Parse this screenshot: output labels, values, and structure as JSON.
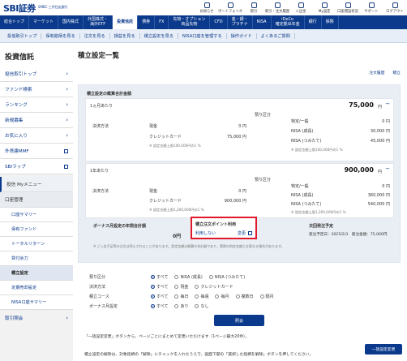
{
  "header": {
    "logo": "SBI証券",
    "logo_sub": "SMBC 三井住友銀行",
    "icons": [
      {
        "name": "notice-icon",
        "label": "お知らせ"
      },
      {
        "name": "portfolio-icon",
        "label": "ポートフォリオ"
      },
      {
        "name": "transfer-icon",
        "label": "取引"
      },
      {
        "name": "history-icon",
        "label": "取引・注文履歴"
      },
      {
        "name": "deposit-icon",
        "label": "入出金"
      },
      {
        "name": "mypage-icon",
        "label": "My設定"
      },
      {
        "name": "ideco-icon",
        "label": "口座開設状況"
      },
      {
        "name": "support-icon",
        "label": "サポート"
      },
      {
        "name": "logout-icon",
        "label": "ログアウト"
      }
    ]
  },
  "mainnav": [
    "総合トップ",
    "マーケット",
    "国内株式",
    "外国株式・\n海外ETF",
    "投資信託",
    "債券",
    "FX",
    "先物・オプション\n商品先物",
    "CFD",
    "金・銀・\nプラチナ",
    "NISA",
    "iDeCo\n確定拠出年金",
    "銀行",
    "保険"
  ],
  "subnav": [
    "投信取引トップ",
    "保有銘柄を見る",
    "注文を見る",
    "損益を見る",
    "積立設定を見る",
    "NISA口座を管理する",
    "操作ガイド",
    "よくあるご質問"
  ],
  "sidebar": {
    "title": "投資信託",
    "items": [
      "投信取引トップ",
      "ファンド検索",
      "ランキング",
      "新規募集",
      "お気に入り",
      "外貨建MMF",
      "SBIラップ"
    ],
    "section_my": "投信 Myメニュー",
    "section_account": "口座管理",
    "sub_items": [
      "口座サマリー",
      "保有ファンド",
      "トータルリターン",
      "買付余力",
      "積立設定",
      "定期売却設定",
      "NISA口座サマリー"
    ],
    "bottom": "取引照会"
  },
  "page": {
    "title": "積立設定一覧",
    "link_history": "注文履歴",
    "link_top": "積立"
  },
  "summary": {
    "heading": "積立設定の概算合計金額",
    "month_label": "1ヵ月あたり",
    "month_total": "75,000",
    "yen": "円",
    "method_label": "決済方法",
    "cash_label": "現金",
    "cash_month": "0 円",
    "credit_label": "クレジットカード",
    "credit_month": "75,000 円",
    "credit_note_m": "※ 設定金額上限100,000円の1 %",
    "account_label": "預り区分",
    "specific_label": "特定/一般",
    "specific_month": "0 円",
    "nisa_growth_label": "NISA (成長)",
    "nisa_growth_month": "30,000 円",
    "nisa_tsumi_label": "NISA (つみたて)",
    "nisa_tsumi_month": "45,000 円",
    "nisa_note_m": "※ 設定金額上限100,000円の1 %",
    "year_label": "1年あたり",
    "year_total": "900,000",
    "cash_year": "0 円",
    "credit_year": "900,000 円",
    "credit_note_y": "※ 設定金額上限1,200,000円の1 %",
    "specific_year": "0 円",
    "nisa_growth_year": "360,000 円",
    "nisa_tsumi_year": "540,000 円",
    "nisa_note_y": "※ 設定金額上限1,200,000円の1 %",
    "bonus_label": "ボーナス月設定の年間合計額",
    "bonus_value": "0円",
    "point_label": "積立注文ポイント利用",
    "point_value": "利用しない",
    "point_change": "変更",
    "next_label": "次回発注予定",
    "next_value": "発注予定日：2025/2/3　発注金額：75,000円",
    "disclaimer": "※ ご入金不足等の注文は停止されることがあります。設定金額は概算の合計額であり、実際の約定金額とは異なる場合があります。"
  },
  "filter": {
    "rows": [
      {
        "label": "預り区分",
        "options": [
          "すべて",
          "NISA (成長)",
          "NISA (つみたて)"
        ]
      },
      {
        "label": "決済方法",
        "options": [
          "すべて",
          "現金",
          "クレジットカード"
        ]
      },
      {
        "label": "積立コース",
        "options": [
          "すべて",
          "毎日",
          "毎週",
          "毎月",
          "複数日",
          "隔月"
        ]
      },
      {
        "label": "ボーナス月設定",
        "options": [
          "すべて",
          "あり",
          "なし"
        ]
      }
    ],
    "search_button": "照会"
  },
  "footer": {
    "line1": "「一括設定変更」ボタンから、ページごとにまとめて変更いただけます（1ページ最大20件）。",
    "line2": "積立設定の解除は、対象銘柄の「解除」にチェックを入れたうえで、画面下部の「選択した銘柄を解除」ボタンを押してください。",
    "bulk_button": "一括設定変更"
  }
}
